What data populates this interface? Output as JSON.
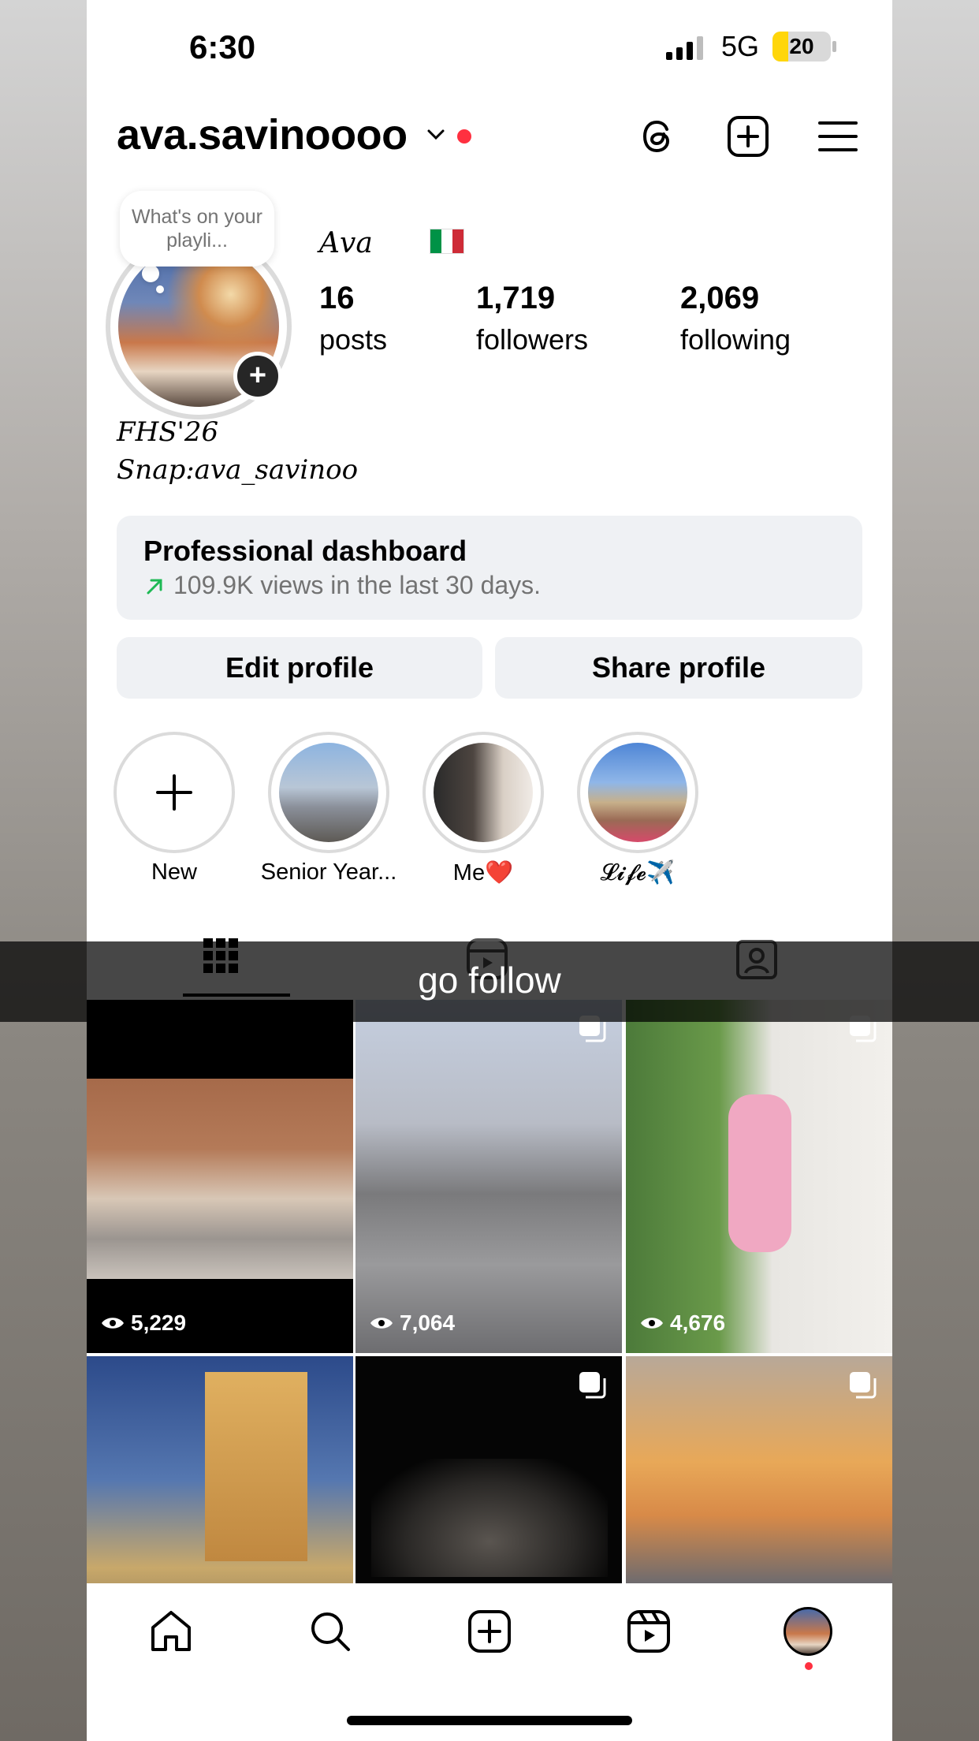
{
  "status_bar": {
    "time": "6:30",
    "network": "5G",
    "battery": "20"
  },
  "header": {
    "username": "ava.savinoooo",
    "icons": [
      "threads-icon",
      "create-icon",
      "menu-icon"
    ]
  },
  "profile": {
    "note": "What's on your playli...",
    "full_name": "𝐴𝑣𝑎",
    "flag": "italy-flag",
    "stats": [
      {
        "number": "16",
        "label": "posts"
      },
      {
        "number": "1,719",
        "label": "followers"
      },
      {
        "number": "2,069",
        "label": "following"
      }
    ],
    "bio_line1": "FHS'26",
    "bio_line2": "Snap:ava_savinoo"
  },
  "dashboard": {
    "title": "Professional dashboard",
    "subtitle": "109.9K views in the last 30 days."
  },
  "buttons": {
    "edit": "Edit profile",
    "share": "Share profile"
  },
  "highlights": [
    {
      "label": "New"
    },
    {
      "label": "Senior Year..."
    },
    {
      "label": "Me❤️"
    },
    {
      "label": "𝓛𝓲𝓯𝓮✈️"
    }
  ],
  "tabs": [
    "grid-icon",
    "reels-icon",
    "tagged-icon"
  ],
  "overlay_caption": "go follow",
  "posts": [
    {
      "views": "5,229",
      "multi": false
    },
    {
      "views": "7,064",
      "multi": true
    },
    {
      "views": "4,676",
      "multi": true
    },
    {
      "views": "",
      "multi": false
    },
    {
      "views": "",
      "multi": true
    },
    {
      "views": "",
      "multi": true
    }
  ],
  "bottom_nav": [
    "home-icon",
    "search-icon",
    "create-icon",
    "reels-icon",
    "profile-avatar"
  ],
  "colors": {
    "accent_red": "#ff3040",
    "button_bg": "#eff1f4",
    "dash_arrow": "#1db954"
  }
}
